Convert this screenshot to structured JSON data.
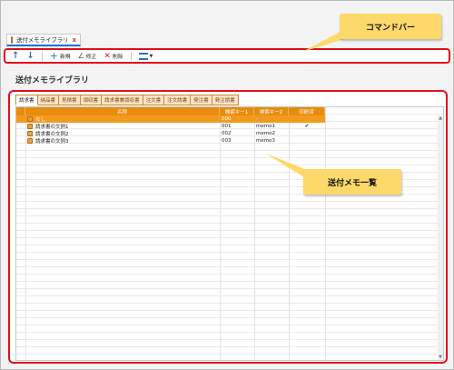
{
  "document_tab": {
    "label": "送付メモライブラリ",
    "close": "x",
    "icon": "document-icon"
  },
  "toolbar": {
    "up_icon": "↑",
    "down_icon": "↓",
    "new_label": "新規",
    "edit_label": "修正",
    "delete_label": "削除"
  },
  "callouts": {
    "command_bar": "コマンドバー",
    "memo_list": "送付メモ一覧"
  },
  "page": {
    "title": "送付メモライブラリ"
  },
  "tabs": [
    "請求書",
    "納品書",
    "見積書",
    "領収書",
    "請求書兼領収書",
    "注文書",
    "注文請書",
    "発注書",
    "発注請書"
  ],
  "table": {
    "columns": [
      "名称",
      "検索キー1",
      "検索キー2",
      "印刷済"
    ],
    "rows": [
      {
        "name": "なし",
        "key1": "000",
        "key2": "-",
        "done": ""
      },
      {
        "name": "請求書の文例1",
        "key1": "001",
        "key2": "memo1",
        "done": "✔"
      },
      {
        "name": "請求書の文例2",
        "key1": "002",
        "key2": "memo2",
        "done": ""
      },
      {
        "name": "請求書の文例3",
        "key1": "003",
        "key2": "memo3",
        "done": ""
      }
    ]
  },
  "colors": {
    "accent_orange": "#e88c0e",
    "highlight_red": "#e20d1a",
    "callout_yellow": "#fcd96a",
    "tab_blue": "#1d6fd6"
  }
}
